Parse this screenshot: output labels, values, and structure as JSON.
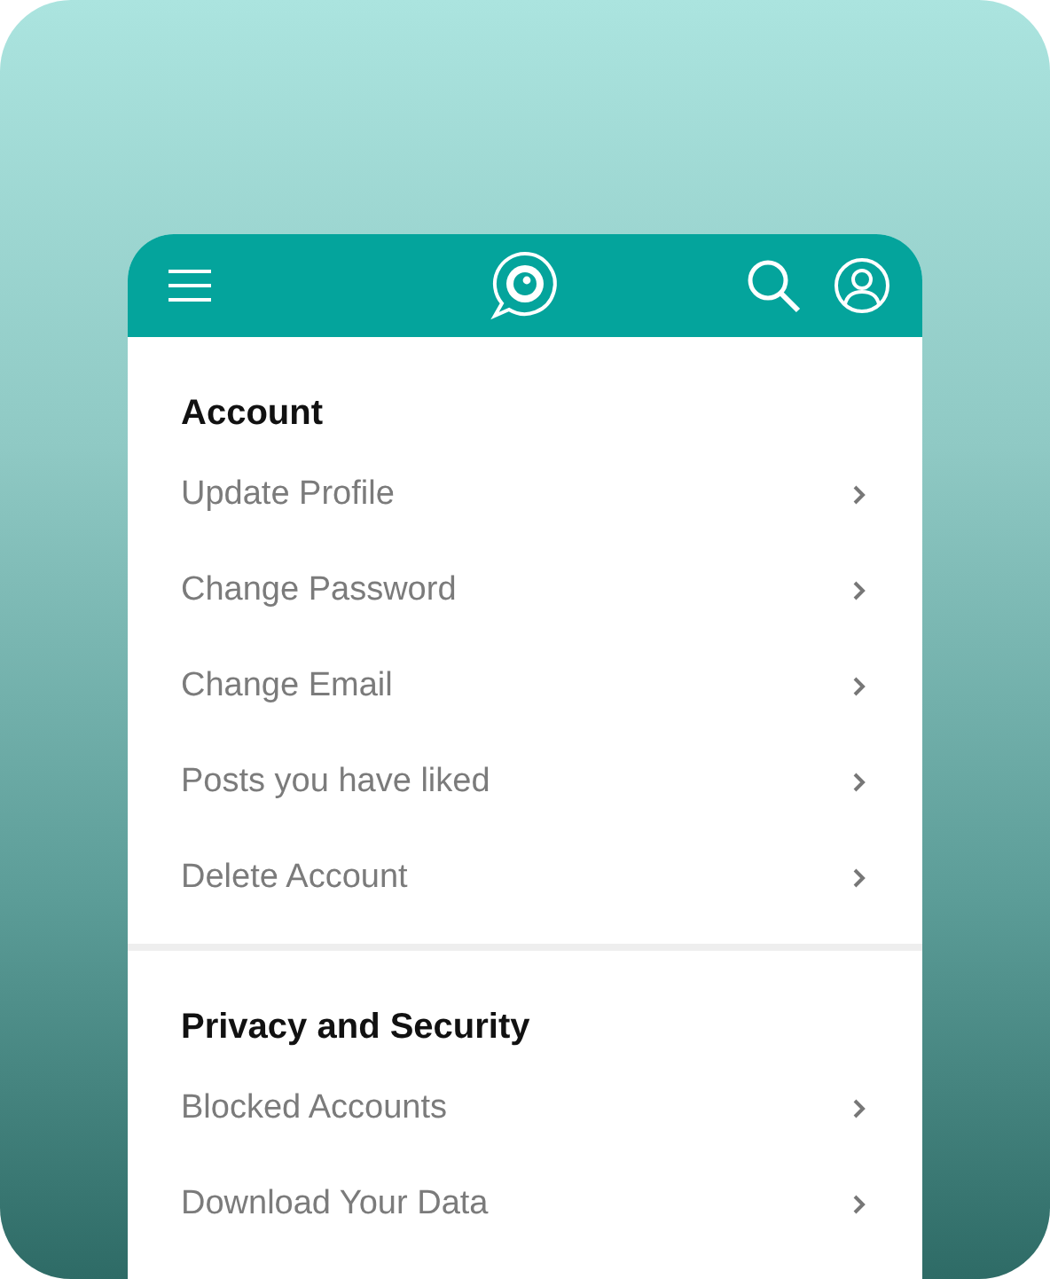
{
  "sections": [
    {
      "title": "Account",
      "items": [
        {
          "label": "Update Profile"
        },
        {
          "label": "Change Password"
        },
        {
          "label": "Change Email"
        },
        {
          "label": "Posts you have liked"
        },
        {
          "label": "Delete Account"
        }
      ]
    },
    {
      "title": "Privacy and Security",
      "items": [
        {
          "label": "Blocked Accounts"
        },
        {
          "label": "Download Your Data"
        }
      ]
    }
  ]
}
